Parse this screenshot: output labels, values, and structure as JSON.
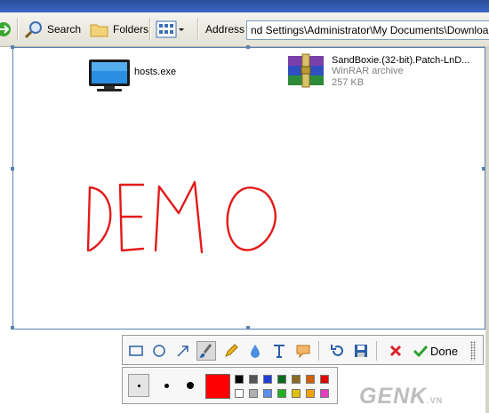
{
  "toolbar": {
    "search_label": "Search",
    "folders_label": "Folders",
    "address_label": "Address",
    "address_value": "nd Settings\\Administrator\\My Documents\\Downloads"
  },
  "files": [
    {
      "name": "hosts.exe"
    },
    {
      "name": "SandBoxie.(32-bit).Patch-LnD...",
      "type": "WinRAR archive",
      "size": "257 KB"
    }
  ],
  "drawing": {
    "text": "DEMO",
    "color": "#e41a1a"
  },
  "annotation_tools": [
    "rectangle-tool",
    "ellipse-tool",
    "arrow-tool",
    "highlighter-tool",
    "pencil-tool",
    "blur-tool",
    "text-tool",
    "callout-tool",
    "undo-tool",
    "save-tool",
    "cancel-tool"
  ],
  "done_label": "Done",
  "current_color": "#ff0000",
  "palette": {
    "row1": [
      "#000000",
      "#555555",
      "#1f3fd8",
      "#0b6b20",
      "#8a6a20",
      "#d06000",
      "#e00000"
    ],
    "row2": [
      "#ffffff",
      "#b0b0b0",
      "#5a8ee8",
      "#20b020",
      "#e0c000",
      "#f0a000",
      "#e040c0"
    ]
  },
  "watermark": {
    "brand": "GENK",
    "suffix": ".VN"
  }
}
